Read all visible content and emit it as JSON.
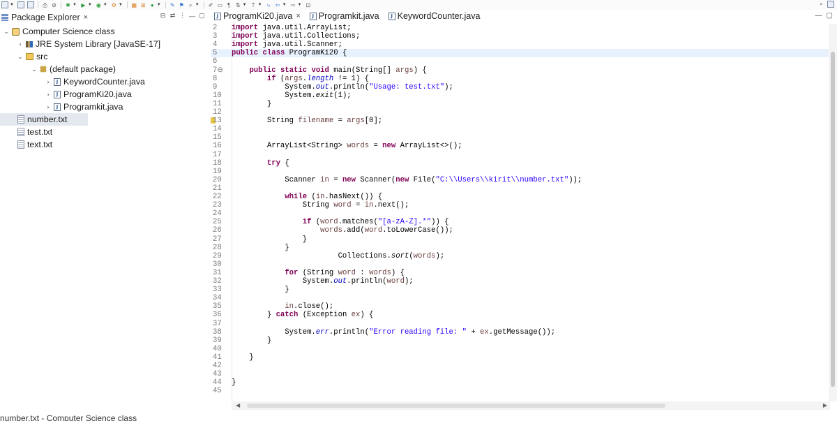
{
  "toolbar": {
    "icons": [
      "new-icon",
      "save-icon",
      "save-all-icon",
      "print-icon",
      "debug-icon",
      "run-icon",
      "run-external-icon",
      "new-java-project-icon",
      "new-package-icon",
      "new-class-icon",
      "open-type-icon",
      "search-icon",
      "annotation-icon",
      "back-icon",
      "forward-icon",
      "perspective-icon"
    ]
  },
  "explorer": {
    "title": "Package Explorer",
    "close": "×",
    "tree": [
      {
        "label": "Computer Science class",
        "icon": "project-icon",
        "chev": "⌄",
        "indent": 0
      },
      {
        "label": "JRE System Library [JavaSE-17]",
        "icon": "jre-library-icon",
        "chev": "›",
        "indent": 1
      },
      {
        "label": "src",
        "icon": "source-folder-icon",
        "chev": "⌄",
        "indent": 1
      },
      {
        "label": "(default package)",
        "icon": "package-icon",
        "chev": "⌄",
        "indent": 2
      },
      {
        "label": "KeywordCounter.java",
        "icon": "java-file-icon",
        "chev": "›",
        "indent": 3
      },
      {
        "label": "ProgramKi20.java",
        "icon": "java-file-icon",
        "chev": "›",
        "indent": 3
      },
      {
        "label": "Programkit.java",
        "icon": "java-file-icon",
        "chev": "›",
        "indent": 3
      },
      {
        "label": "number.txt",
        "icon": "text-file-icon",
        "chev": "",
        "indent": 1,
        "selected": true
      },
      {
        "label": "test.txt",
        "icon": "text-file-icon",
        "chev": "",
        "indent": 1
      },
      {
        "label": "text.txt",
        "icon": "text-file-icon",
        "chev": "",
        "indent": 1
      }
    ],
    "status": "number.txt - Computer Science class"
  },
  "editor": {
    "tabs": [
      {
        "label": "ProgramKi20.java",
        "close": "×",
        "active": true
      },
      {
        "label": "Programkit.java",
        "close": "",
        "active": false
      },
      {
        "label": "KeywordCounter.java",
        "close": "",
        "active": false
      }
    ],
    "lines": [
      {
        "n": "2",
        "html": "<span class=\"kw\">import</span> java.util.ArrayList;"
      },
      {
        "n": "3",
        "html": "<span class=\"kw\">import</span> java.util.Collections;"
      },
      {
        "n": "4",
        "html": "<span class=\"kw\">import</span> java.util.Scanner;"
      },
      {
        "n": "5",
        "html": "<span class=\"kw\">public</span> <span class=\"kw\">class</span> ProgramKi20 {",
        "hl": true
      },
      {
        "n": "6",
        "html": ""
      },
      {
        "n": "7⊖",
        "html": "    <span class=\"kw\">public</span> <span class=\"kw\">static</span> <span class=\"kw\">void</span> main(String[] <span class=\"var\">args</span>) {"
      },
      {
        "n": "8",
        "html": "        <span class=\"kw\">if</span> (<span class=\"var\">args</span>.<span class=\"fld\">length</span> != 1) {"
      },
      {
        "n": "9",
        "html": "            System.<span class=\"fld\">out</span>.println(<span class=\"str\">\"Usage: test.txt\"</span>);"
      },
      {
        "n": "10",
        "html": "            System.<span class=\"ital\">exit</span>(1);"
      },
      {
        "n": "11",
        "html": "        }"
      },
      {
        "n": "12",
        "html": ""
      },
      {
        "n": "13",
        "html": "        String <span class=\"var\">filename</span> = <span class=\"var\">args</span>[0];",
        "warn": true
      },
      {
        "n": "14",
        "html": ""
      },
      {
        "n": "15",
        "html": ""
      },
      {
        "n": "16",
        "html": "        ArrayList&lt;String&gt; <span class=\"var\">words</span> = <span class=\"kw\">new</span> ArrayList&lt;&gt;();"
      },
      {
        "n": "17",
        "html": ""
      },
      {
        "n": "18",
        "html": "        <span class=\"kw\">try</span> {"
      },
      {
        "n": "19",
        "html": ""
      },
      {
        "n": "20",
        "html": "            Scanner <span class=\"var\">in</span> = <span class=\"kw\">new</span> Scanner(<span class=\"kw\">new</span> File(<span class=\"str\">\"C:\\\\Users\\\\kirit\\\\number.txt\"</span>));"
      },
      {
        "n": "21",
        "html": ""
      },
      {
        "n": "22",
        "html": "            <span class=\"kw\">while</span> (<span class=\"var\">in</span>.hasNext()) {"
      },
      {
        "n": "23",
        "html": "                String <span class=\"var\">word</span> = <span class=\"var\">in</span>.next();"
      },
      {
        "n": "24",
        "html": ""
      },
      {
        "n": "25",
        "html": "                <span class=\"kw\">if</span> (<span class=\"var\">word</span>.matches(<span class=\"str\">\"[a-zA-Z].*\"</span>)) {"
      },
      {
        "n": "26",
        "html": "                    <span class=\"var\">words</span>.add(<span class=\"var\">word</span>.toLowerCase());"
      },
      {
        "n": "27",
        "html": "                }"
      },
      {
        "n": "28",
        "html": "            }"
      },
      {
        "n": "29",
        "html": "                        Collections.<span class=\"ital\">sort</span>(<span class=\"var\">words</span>);"
      },
      {
        "n": "30",
        "html": ""
      },
      {
        "n": "31",
        "html": "            <span class=\"kw\">for</span> (String <span class=\"var\">word</span> : <span class=\"var\">words</span>) {"
      },
      {
        "n": "32",
        "html": "                System.<span class=\"fld\">out</span>.println(<span class=\"var\">word</span>);"
      },
      {
        "n": "33",
        "html": "            }"
      },
      {
        "n": "34",
        "html": ""
      },
      {
        "n": "35",
        "html": "            <span class=\"var\">in</span>.close();"
      },
      {
        "n": "36",
        "html": "        } <span class=\"kw\">catch</span> (Exception <span class=\"var\">ex</span>) {"
      },
      {
        "n": "37",
        "html": ""
      },
      {
        "n": "38",
        "html": "            System.<span class=\"fld\">err</span>.println(<span class=\"str\">\"Error reading file: \"</span> + <span class=\"var\">ex</span>.getMessage());"
      },
      {
        "n": "39",
        "html": "        }"
      },
      {
        "n": "40",
        "html": ""
      },
      {
        "n": "41",
        "html": "    }"
      },
      {
        "n": "42",
        "html": ""
      },
      {
        "n": "43",
        "html": ""
      },
      {
        "n": "44",
        "html": "}"
      },
      {
        "n": "45",
        "html": ""
      }
    ]
  }
}
